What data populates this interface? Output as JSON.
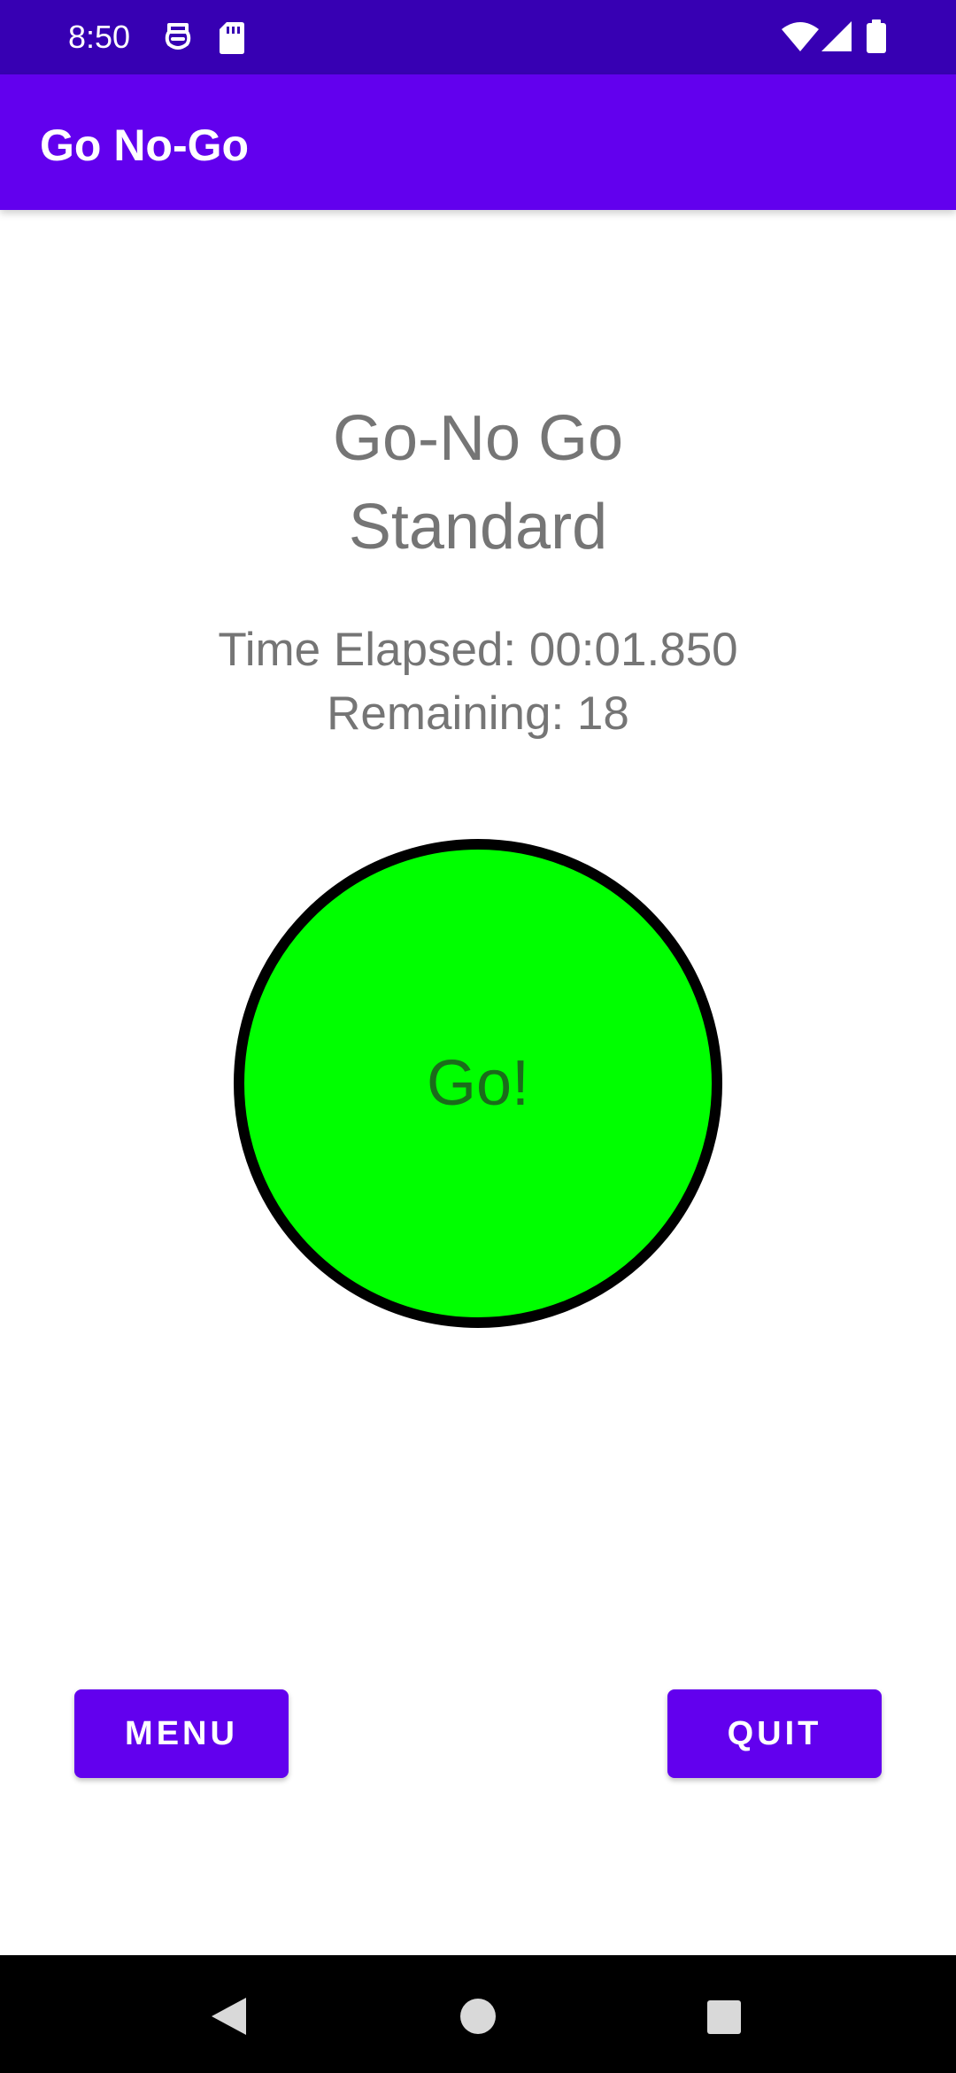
{
  "status_bar": {
    "time": "8:50",
    "background_color": "#3700b3",
    "icons": [
      "assistant-icon",
      "sd-card-icon",
      "wifi-icon",
      "signal-icon",
      "battery-icon"
    ]
  },
  "app_bar": {
    "title": "Go No-Go",
    "background_color": "#6200ee"
  },
  "main": {
    "title_line1": "Go-No Go",
    "title_line2": "Standard",
    "time_elapsed": "Time Elapsed: 00:01.850",
    "remaining": "Remaining: 18",
    "stimulus": {
      "label": "Go!",
      "fill_color": "#00ff00",
      "border_color": "#000000"
    }
  },
  "buttons": {
    "menu_label": "MENU",
    "quit_label": "QUIT",
    "color": "#6200ee"
  },
  "nav_bar": {
    "icons": [
      "back-icon",
      "home-icon",
      "recents-icon"
    ]
  }
}
